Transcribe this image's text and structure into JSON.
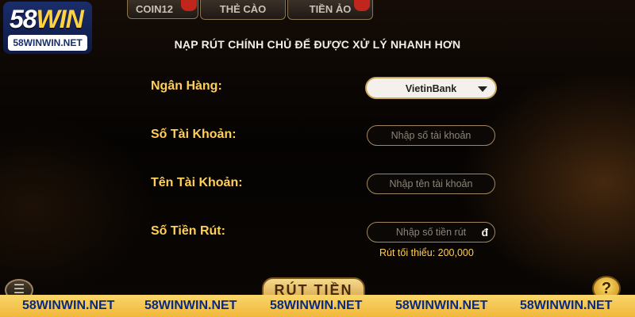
{
  "brand": {
    "logo_number": "58",
    "logo_word": "WIN",
    "logo_domain": "58WINWIN.NET"
  },
  "tabs": [
    {
      "label": "COIN12"
    },
    {
      "label": "THẺ CÀO"
    },
    {
      "label": "TIỀN ẢO"
    }
  ],
  "notice": "NẠP RÚT CHÍNH CHỦ ĐỂ ĐƯỢC XỬ LÝ NHANH HƠN",
  "form": {
    "bank_label": "Ngân Hàng:",
    "bank_value": "VietinBank",
    "account_number_label": "Số Tài Khoản:",
    "account_number_placeholder": "Nhập số tài  khoản",
    "account_name_label": "Tên Tài Khoản:",
    "account_name_placeholder": "Nhập tên tài khoản",
    "amount_label": "Số Tiền Rút:",
    "amount_placeholder": "Nhập số tiền rút",
    "currency_symbol": "đ",
    "min_withdraw_note": "Rút tối thiểu: 200,000"
  },
  "actions": {
    "withdraw_label": "RÚT TIỀN",
    "help_symbol": "?"
  },
  "banner": [
    "58WINWIN.NET",
    "58WINWIN.NET",
    "58WINWIN.NET",
    "58WINWIN.NET",
    "58WINWIN.NET"
  ],
  "colors": {
    "accent_gold": "#ffcf57",
    "banner_text": "#0a2a80"
  },
  "icons": {
    "menu": "menu-icon",
    "help": "help-icon",
    "dropdown": "chevron-down-icon"
  }
}
